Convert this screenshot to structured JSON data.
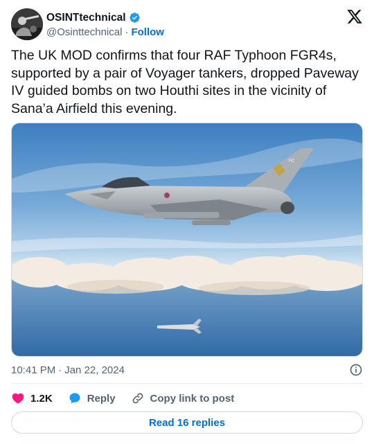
{
  "author": {
    "display_name": "OSINTtechnical",
    "handle": "@Osinttechnical",
    "separator": "·",
    "follow_label": "Follow",
    "verified_color": "#1d9bf0"
  },
  "tweet": {
    "text": "The UK MOD confirms that four RAF Typhoon FGR4s, supported by a pair of Voyager tankers, dropped Paveway IV guided bombs on two Houthi sites in the vicinity of Sana’a Airfield this evening.",
    "image_tail_code": "FC"
  },
  "meta": {
    "time": "10:41 PM",
    "separator": "·",
    "date": "Jan 22, 2024"
  },
  "actions": {
    "likes_count": "1.2K",
    "reply_label": "Reply",
    "copy_link_label": "Copy link to post"
  },
  "read_replies_label": "Read 16 replies",
  "colors": {
    "like": "#f91880",
    "reply": "#1d9bf0",
    "link_blue": "#006fd6",
    "muted": "#536471"
  }
}
